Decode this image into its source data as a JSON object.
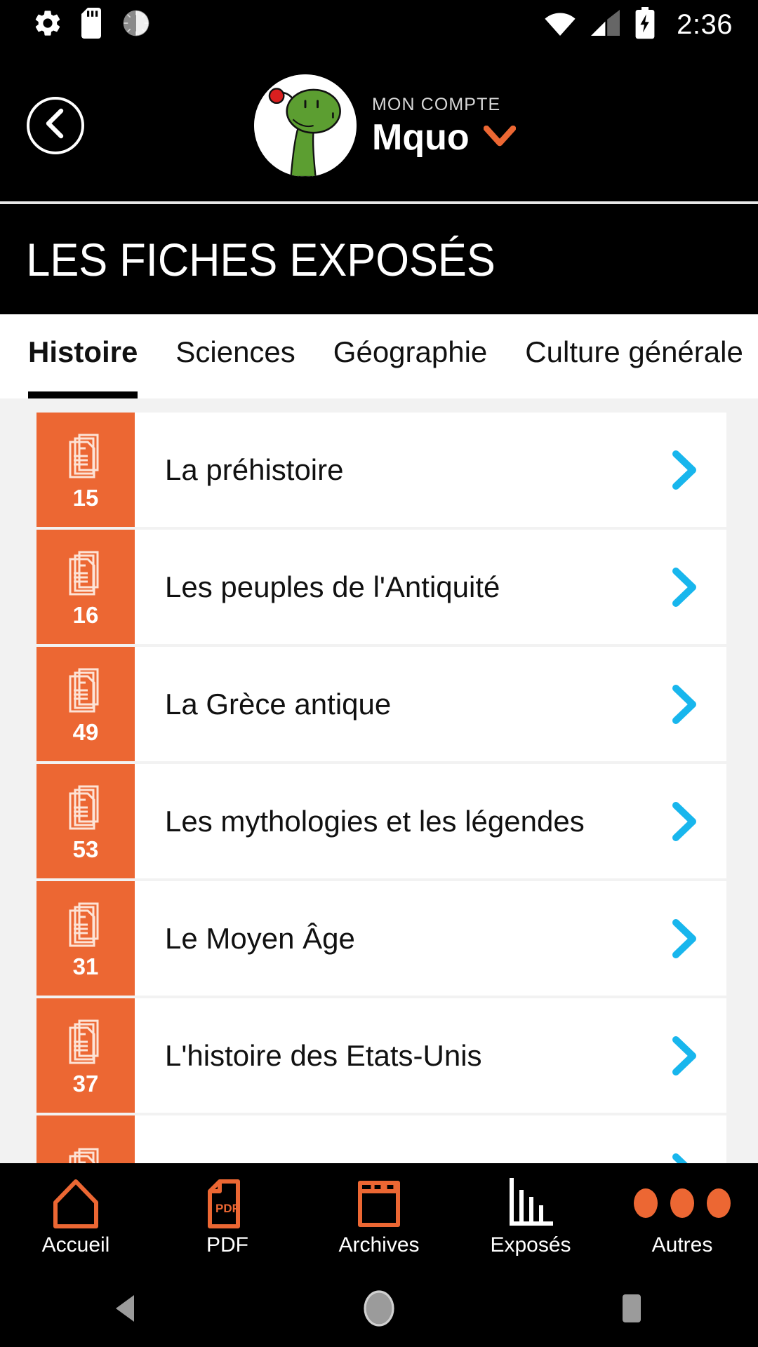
{
  "statusbar": {
    "time": "2:36",
    "icons": [
      "settings-gear-icon",
      "sd-card-icon",
      "dial-icon",
      "wifi-icon",
      "cellular-signal-icon",
      "battery-charging-icon"
    ]
  },
  "header": {
    "back_icon": "chevron-left-icon",
    "avatar_icon": "dinosaur-avatar",
    "account_label": "MON COMPTE",
    "account_name": "Mquo",
    "dropdown_icon": "chevron-down-icon",
    "dropdown_color": "#EC6733"
  },
  "page": {
    "title": "LES FICHES EXPOSÉS"
  },
  "tabs": {
    "active_index": 0,
    "items": [
      {
        "label": "Histoire"
      },
      {
        "label": "Sciences"
      },
      {
        "label": "Géographie"
      },
      {
        "label": "Culture générale"
      }
    ]
  },
  "list": {
    "badge_color": "#EC6733",
    "chevron_color": "#18B6ED",
    "row_icon": "stacked-documents-icon",
    "chevron_icon": "chevron-right-icon",
    "rows": [
      {
        "count": "15",
        "title": "La préhistoire"
      },
      {
        "count": "16",
        "title": "Les peuples de l'Antiquité"
      },
      {
        "count": "49",
        "title": "La Grèce antique"
      },
      {
        "count": "53",
        "title": "Les mythologies et les légendes"
      },
      {
        "count": "31",
        "title": "Le Moyen Âge"
      },
      {
        "count": "37",
        "title": "L'histoire des Etats-Unis"
      },
      {
        "count": "",
        "title": ""
      }
    ]
  },
  "bottomnav": {
    "active_index": 3,
    "accent_color": "#EC6733",
    "active_color": "#FFFFFF",
    "items": [
      {
        "label": "Accueil",
        "icon": "home-icon"
      },
      {
        "label": "PDF",
        "icon": "pdf-file-icon"
      },
      {
        "label": "Archives",
        "icon": "archive-box-icon"
      },
      {
        "label": "Exposés",
        "icon": "bar-chart-icon"
      },
      {
        "label": "Autres",
        "icon": "more-dots-icon"
      }
    ]
  },
  "androidnav": {
    "items": [
      {
        "icon": "android-back-icon"
      },
      {
        "icon": "android-home-icon"
      },
      {
        "icon": "android-recents-icon"
      }
    ]
  }
}
